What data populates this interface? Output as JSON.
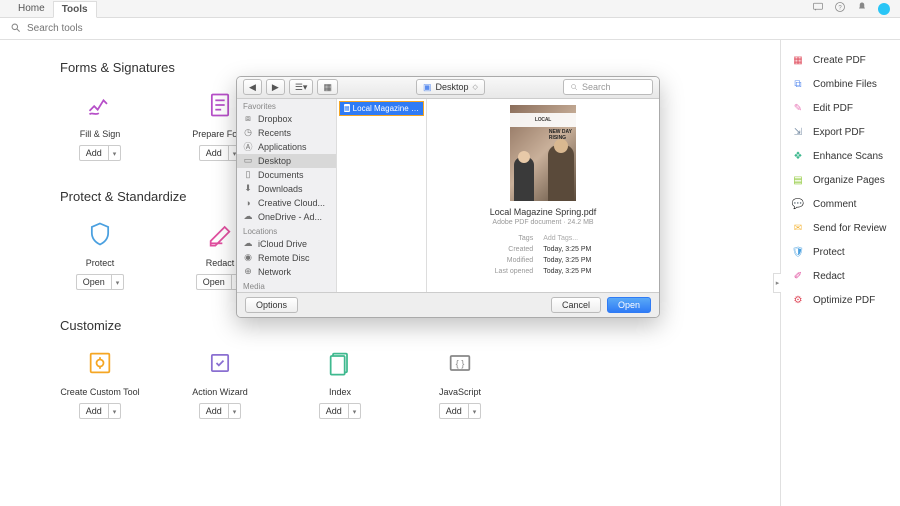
{
  "tabs": {
    "home": "Home",
    "tools": "Tools"
  },
  "search": {
    "placeholder": "Search tools"
  },
  "sections": {
    "forms": {
      "title": "Forms & Signatures",
      "items": [
        {
          "label": "Fill & Sign",
          "btn": "Add"
        },
        {
          "label": "Prepare Form",
          "btn": "Add"
        }
      ]
    },
    "protect": {
      "title": "Protect & Standardize",
      "items": [
        {
          "label": "Protect",
          "btn": "Open"
        },
        {
          "label": "Redact",
          "btn": "Open"
        }
      ]
    },
    "customize": {
      "title": "Customize",
      "items": [
        {
          "label": "Create Custom Tool",
          "btn": "Add"
        },
        {
          "label": "Action Wizard",
          "btn": "Add"
        },
        {
          "label": "Index",
          "btn": "Add"
        },
        {
          "label": "JavaScript",
          "btn": "Add"
        }
      ]
    }
  },
  "right_panel": [
    {
      "label": "Create PDF",
      "icon": "create",
      "color": "#e04f5f"
    },
    {
      "label": "Combine Files",
      "icon": "combine",
      "color": "#5b8def"
    },
    {
      "label": "Edit PDF",
      "icon": "edit",
      "color": "#e879b8"
    },
    {
      "label": "Export PDF",
      "icon": "export",
      "color": "#7a8fa6"
    },
    {
      "label": "Enhance Scans",
      "icon": "scan",
      "color": "#3fb98f"
    },
    {
      "label": "Organize Pages",
      "icon": "organize",
      "color": "#8fc93a"
    },
    {
      "label": "Comment",
      "icon": "comment",
      "color": "#f5b942"
    },
    {
      "label": "Send for Review",
      "icon": "review",
      "color": "#f5b942"
    },
    {
      "label": "Protect",
      "icon": "protect",
      "color": "#4aa0e0"
    },
    {
      "label": "Redact",
      "icon": "redact",
      "color": "#e04f9f"
    },
    {
      "label": "Optimize PDF",
      "icon": "optimize",
      "color": "#e04f5f"
    }
  ],
  "dialog": {
    "toolbar": {
      "location": "Desktop",
      "search": "Search"
    },
    "sidebar": {
      "favorites": {
        "header": "Favorites",
        "items": [
          "Dropbox",
          "Recents",
          "Applications",
          "Desktop",
          "Documents",
          "Downloads",
          "Creative Cloud...",
          "OneDrive - Ad..."
        ]
      },
      "locations": {
        "header": "Locations",
        "items": [
          "iCloud Drive",
          "Remote Disc",
          "Network"
        ]
      },
      "media": {
        "header": "Media"
      }
    },
    "selected_file": "Local Magazine Spring.pdf",
    "preview": {
      "name": "Local Magazine Spring.pdf",
      "meta": "Adobe PDF document · 24.2 MB",
      "tags": {
        "k": "Tags",
        "v": "Add Tags..."
      },
      "created": {
        "k": "Created",
        "v": "Today, 3:25 PM"
      },
      "modified": {
        "k": "Modified",
        "v": "Today, 3:25 PM"
      },
      "opened": {
        "k": "Last opened",
        "v": "Today, 3:25 PM"
      },
      "thumb": {
        "title": "LOCAL",
        "sub": "NEW DAY\nRISING"
      }
    },
    "footer": {
      "options": "Options",
      "cancel": "Cancel",
      "open": "Open"
    }
  }
}
